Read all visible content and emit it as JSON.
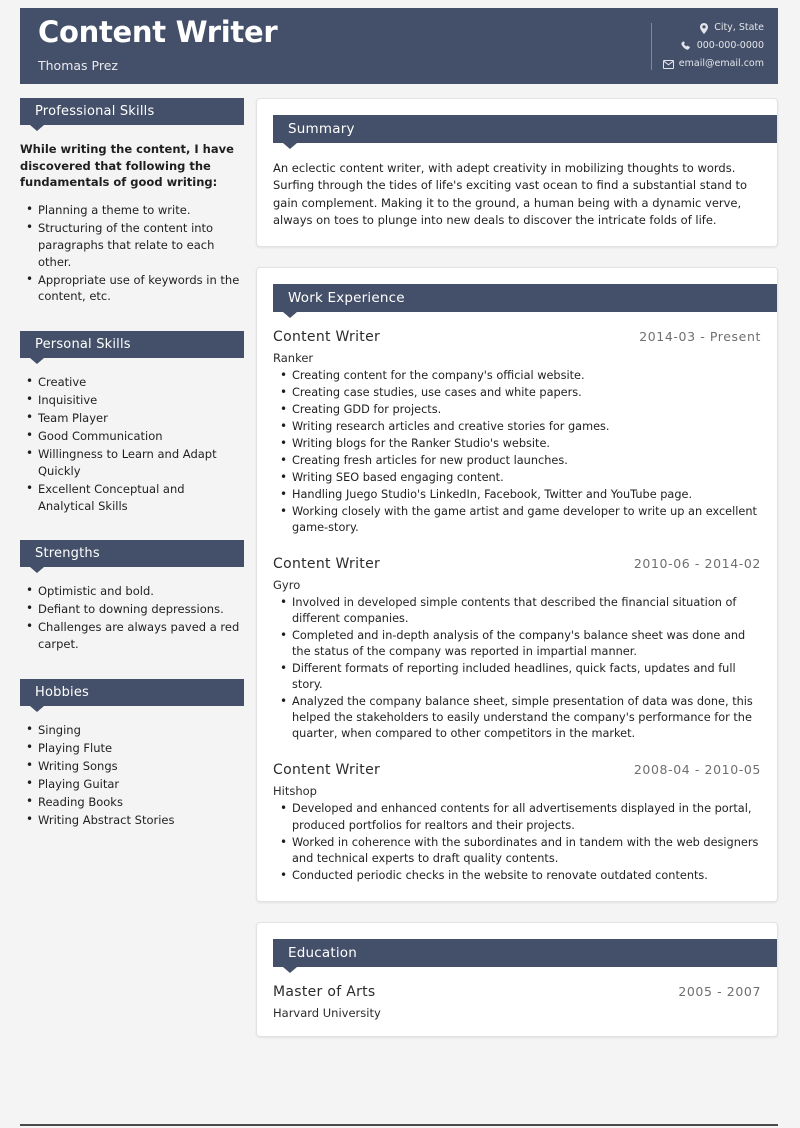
{
  "header": {
    "job_title": "Content Writer",
    "name": "Thomas Prez",
    "contacts": [
      {
        "icon": "location-pin-icon",
        "text": "City, State"
      },
      {
        "icon": "phone-icon",
        "text": "000-000-0000"
      },
      {
        "icon": "envelope-icon",
        "text": "email@email.com"
      }
    ],
    "accent_color": "#445069"
  },
  "sidebar": {
    "professional_skills": {
      "heading": "Professional Skills",
      "intro": "While writing the content, I have discovered that following the fundamentals of good writing:",
      "items": [
        "Planning a theme to write.",
        "Structuring of the content into paragraphs that relate to each other.",
        "Appropriate use of keywords in the content, etc."
      ]
    },
    "personal_skills": {
      "heading": "Personal Skills",
      "items": [
        "Creative",
        "Inquisitive",
        "Team Player",
        "Good Communication",
        "Willingness to Learn and Adapt Quickly",
        "Excellent Conceptual and Analytical Skills"
      ]
    },
    "strengths": {
      "heading": "Strengths",
      "items": [
        "Optimistic and bold.",
        "Defiant to downing depressions.",
        "Challenges are always paved a red carpet."
      ]
    },
    "hobbies": {
      "heading": "Hobbies",
      "items": [
        "Singing",
        "Playing Flute",
        "Writing Songs",
        "Playing Guitar",
        "Reading Books",
        "Writing Abstract Stories"
      ]
    }
  },
  "main": {
    "summary": {
      "heading": "Summary",
      "text": "An eclectic content writer, with adept creativity in mobilizing thoughts to words. Surfing through the tides of life's exciting vast ocean to find a substantial stand to gain complement. Making it to the ground, a human being with a dynamic verve, always on toes to plunge into new deals to discover the intricate folds of life."
    },
    "work_experience": {
      "heading": "Work Experience",
      "jobs": [
        {
          "title": "Content Writer",
          "date": "2014-03 - Present",
          "company": "Ranker",
          "bullets": [
            "Creating content for the company's official website.",
            "Creating case studies, use cases and white papers.",
            "Creating GDD for projects.",
            "Writing research articles and creative stories for games.",
            "Writing blogs for the Ranker Studio's website.",
            "Creating fresh articles for new product launches.",
            "Writing SEO based engaging content.",
            "Handling Juego Studio's LinkedIn, Facebook, Twitter and YouTube page.",
            "Working closely with the game artist and game developer to write up an excellent game-story."
          ]
        },
        {
          "title": "Content Writer",
          "date": "2010-06 - 2014-02",
          "company": "Gyro",
          "bullets": [
            "Involved in developed simple contents that described the financial situation of different companies.",
            "Completed and in-depth analysis of the company's balance sheet was done and the status of the company was reported in impartial manner.",
            "Different formats of reporting included headlines, quick facts, updates and full story.",
            "Analyzed the company balance sheet, simple presentation of data was done, this helped the stakeholders to easily understand  the company's performance for the quarter, when compared to other competitors in the market."
          ]
        },
        {
          "title": "Content Writer",
          "date": "2008-04 - 2010-05",
          "company": "Hitshop",
          "bullets": [
            "Developed and enhanced contents for all advertisements displayed in the portal, produced portfolios for realtors and their projects.",
            "Worked in coherence with the subordinates and in tandem with the web designers and technical experts to draft quality contents.",
            "Conducted periodic checks in the website to renovate outdated contents."
          ]
        }
      ]
    },
    "education": {
      "heading": "Education",
      "entries": [
        {
          "degree": "Master of Arts",
          "date": "2005 - 2007",
          "school": "Harvard University"
        }
      ]
    }
  }
}
